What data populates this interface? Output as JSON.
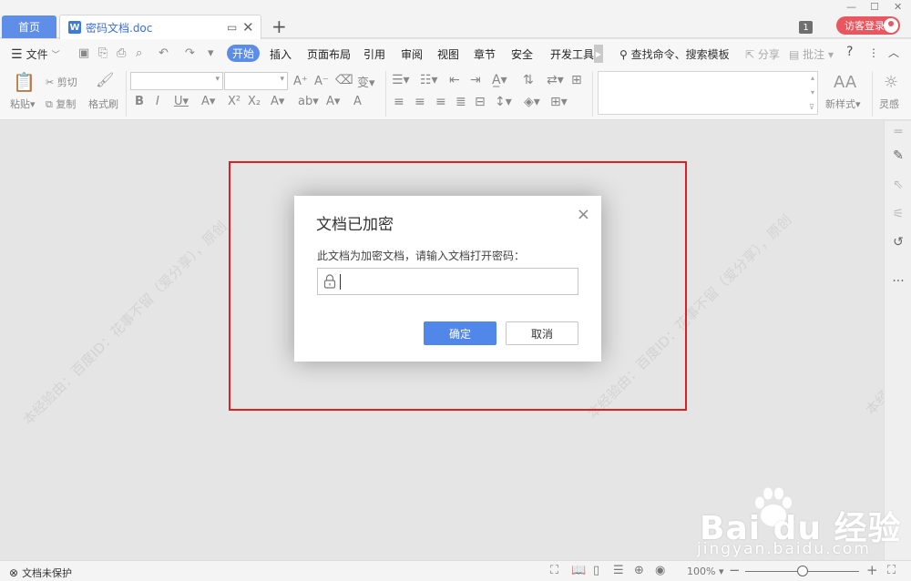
{
  "tabs": {
    "home": "首页",
    "document": "密码文档.doc",
    "doc_icon": "W",
    "new_tab": "+"
  },
  "title_right": {
    "counter": "1",
    "visitor_login": "访客登录"
  },
  "menu": {
    "file": "文件",
    "items": [
      "开始",
      "插入",
      "页面布局",
      "引用",
      "审阅",
      "视图",
      "章节",
      "安全",
      "开发工具"
    ],
    "search": "查找命令、搜索模板",
    "share": "分享",
    "comment": "批注",
    "help": "?"
  },
  "ribbon": {
    "paste": "粘贴",
    "cut": "剪切",
    "copy": "复制",
    "format_painter": "格式刷",
    "new_style": "新样式",
    "inspiration": "灵感"
  },
  "watermark": {
    "text": "本经验由：百度ID：花事不留（爱分享），原创"
  },
  "dialog": {
    "title": "文档已加密",
    "message": "此文档为加密文档，请输入文档打开密码：",
    "password_value": "",
    "ok_label": "确定",
    "cancel_label": "取消",
    "close_icon": "×"
  },
  "brand": {
    "logo_text": "Bai  du 经验",
    "url": "jingyan.baidu.com"
  },
  "status": {
    "protection": "文档未保护",
    "zoom": "100%"
  },
  "colors": {
    "accent": "#5287ea",
    "home_tab": "#5f8ee8",
    "visitor": "#e8565f",
    "highlight": "#e02020"
  }
}
